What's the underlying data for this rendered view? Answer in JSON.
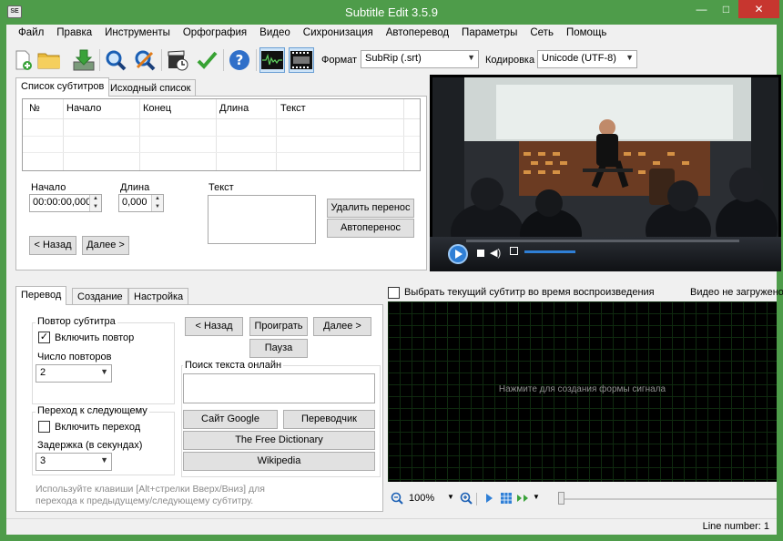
{
  "window": {
    "title": "Subtitle Edit 3.5.9",
    "app_icon_text": "SE"
  },
  "menu": [
    "Файл",
    "Правка",
    "Инструменты",
    "Орфография",
    "Видео",
    "Сихронизация",
    "Автоперевод",
    "Параметры",
    "Сеть",
    "Помощь"
  ],
  "toolbar": {
    "format_label": "Формат",
    "format_value": "SubRip (.srt)",
    "encoding_label": "Кодировка",
    "encoding_value": "Unicode (UTF-8)"
  },
  "subtitle_tabs": {
    "list": "Список субтитров",
    "source": "Исходный список"
  },
  "grid": {
    "columns": [
      "№",
      "Начало",
      "Конец",
      "Длина",
      "Текст"
    ]
  },
  "editor": {
    "start_label": "Начало",
    "start_value": "00:00:00,000",
    "duration_label": "Длина",
    "duration_value": "0,000",
    "text_label": "Текст",
    "remove_linebreak": "Удалить перенос",
    "auto_linebreak": "Автоперенос",
    "prev": "< Назад",
    "next": "Далее >"
  },
  "bottom_tabs": {
    "translate": "Перевод",
    "create": "Создание",
    "settings": "Настройка"
  },
  "repeat": {
    "group_title": "Повтор субтитра",
    "enable_label": "Включить повтор",
    "enable_checked": true,
    "count_label": "Число повторов",
    "count_value": "2"
  },
  "goto_next": {
    "group_title": "Переход к следующему",
    "enable_label": "Включить переход",
    "enable_checked": false,
    "delay_label": "Задержка (в секундах)",
    "delay_value": "3"
  },
  "playback": {
    "prev": "< Назад",
    "play": "Проиграть",
    "next": "Далее >",
    "pause": "Пауза"
  },
  "search": {
    "group_title": "Поиск текста онлайн",
    "google": "Сайт Google",
    "translator": "Переводчик",
    "free_dictionary": "The Free Dictionary",
    "wikipedia": "Wikipedia"
  },
  "hint": {
    "line1": "Используйте клавиши [Alt+стрелки Вверх/Вниз] для",
    "line2": "перехода к предыдущему/следующему субтитру."
  },
  "waveform": {
    "select_current_label": "Выбрать текущий субтитр во время воспроизведения",
    "video_status": "Видео не загружено",
    "placeholder": "Нажмите для создания формы сигнала",
    "zoom": "100%"
  },
  "status": {
    "line_number": "Line number: 1"
  },
  "colors": {
    "title_bar": "#4e9c4a",
    "close_button": "#c7362f",
    "accent_blue": "#2f7fd6"
  }
}
